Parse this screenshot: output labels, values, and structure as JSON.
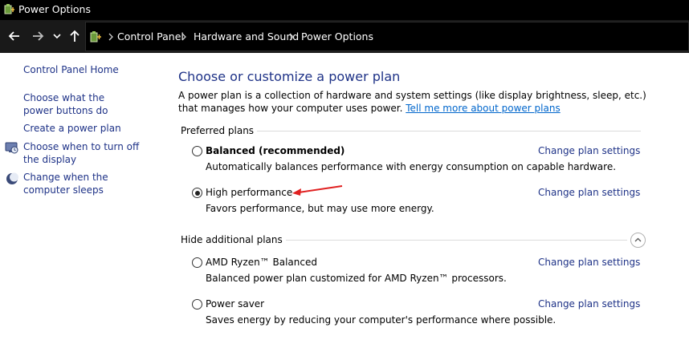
{
  "window": {
    "title": "Power Options",
    "app_icon": "power-options-icon"
  },
  "navigation": {
    "back_icon": "arrow-left-icon",
    "forward_icon": "arrow-right-icon",
    "recent_icon": "chevron-down-icon",
    "up_icon": "arrow-up-icon",
    "breadcrumbs": [
      "Control Panel",
      "Hardware and Sound",
      "Power Options"
    ]
  },
  "sidebar": {
    "items": [
      {
        "label": "Control Panel Home",
        "icon": ""
      },
      {
        "label": "Choose what the power buttons do",
        "icon": ""
      },
      {
        "label": "Create a power plan",
        "icon": ""
      },
      {
        "label": "Choose when to turn off the display",
        "icon": "display-power-icon"
      },
      {
        "label": "Change when the computer sleeps",
        "icon": "moon-sleep-icon"
      }
    ]
  },
  "main": {
    "title": "Choose or customize a power plan",
    "description": "A power plan is a collection of hardware and system settings (like display brightness, sleep, etc.) that manages how your computer uses power.",
    "learn_more_link": "Tell me more about power plans",
    "preferred_header": "Preferred plans",
    "additional_header": "Hide additional plans",
    "plans": [
      {
        "name": "Balanced (recommended)",
        "description": "Automatically balances performance with energy consumption on capable hardware.",
        "link": "Change plan settings",
        "selected": false
      },
      {
        "name": "High performance",
        "description": "Favors performance, but may use more energy.",
        "link": "Change plan settings",
        "selected": true
      },
      {
        "name": "AMD Ryzen™ Balanced",
        "description": "Balanced power plan customized for AMD Ryzen™ processors.",
        "link": "Change plan settings",
        "selected": false
      },
      {
        "name": "Power saver",
        "description": "Saves energy by reducing your computer's performance where possible.",
        "link": "Change plan settings",
        "selected": false
      }
    ]
  },
  "colors": {
    "title_bar": "#000000",
    "link_blue": "#1e3287",
    "hyperlink": "#0066cc",
    "annotation_arrow": "#e02020"
  }
}
